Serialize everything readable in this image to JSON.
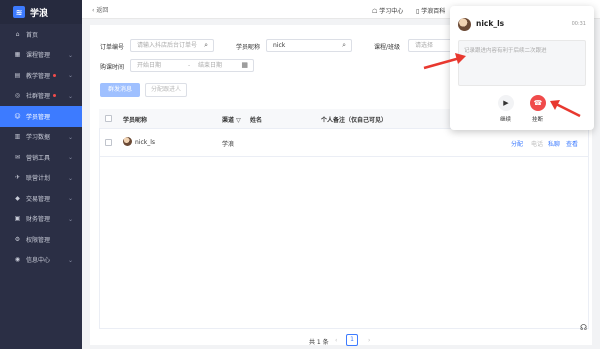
{
  "app": {
    "logo_text": "学浪",
    "logo_mark": "≋"
  },
  "sidebar": {
    "items": [
      {
        "label": "首页",
        "icon": "home-icon",
        "glyph": "⌂",
        "chevron": false,
        "dot": false,
        "active": false
      },
      {
        "label": "课程管理",
        "icon": "course-icon",
        "glyph": "▦",
        "chevron": true,
        "dot": false,
        "active": false
      },
      {
        "label": "教学管理",
        "icon": "teach-icon",
        "glyph": "▤",
        "chevron": true,
        "dot": true,
        "active": false
      },
      {
        "label": "社群管理",
        "icon": "community-icon",
        "glyph": "◎",
        "chevron": true,
        "dot": true,
        "active": false
      },
      {
        "label": "学员管理",
        "icon": "student-icon",
        "glyph": "☺",
        "chevron": false,
        "dot": false,
        "active": true
      },
      {
        "label": "学习数据",
        "icon": "data-icon",
        "glyph": "▥",
        "chevron": true,
        "dot": false,
        "active": false
      },
      {
        "label": "营销工具",
        "icon": "marketing-icon",
        "glyph": "✉",
        "chevron": true,
        "dot": false,
        "active": false
      },
      {
        "label": "联营计划",
        "icon": "plan-icon",
        "glyph": "✈",
        "chevron": true,
        "dot": false,
        "active": false
      },
      {
        "label": "交易管理",
        "icon": "trade-icon",
        "glyph": "◆",
        "chevron": true,
        "dot": false,
        "active": false
      },
      {
        "label": "财务管理",
        "icon": "finance-icon",
        "glyph": "▣",
        "chevron": true,
        "dot": false,
        "active": false
      },
      {
        "label": "权限管理",
        "icon": "permission-icon",
        "glyph": "⚙",
        "chevron": false,
        "dot": false,
        "active": false
      },
      {
        "label": "信息中心",
        "icon": "info-icon",
        "glyph": "◉",
        "chevron": true,
        "dot": false,
        "active": false
      }
    ]
  },
  "topbar": {
    "back_label": "返回",
    "learn_center": "学习中心",
    "wiki": "学浪百科"
  },
  "filters": {
    "order_label": "订单编号",
    "order_placeholder": "请输入抖店后台订单号",
    "nick_label": "学员昵称",
    "nick_value": "nick",
    "course_label": "课程/班级",
    "course_placeholder": "请选择",
    "time_label": "购课时间",
    "start_placeholder": "开始日期",
    "end_placeholder": "结束日期",
    "range_sep": "-"
  },
  "actions": {
    "send_message": "群发消息",
    "assign_advisor": "分配跟进人"
  },
  "table": {
    "headers": {
      "nick": "学员昵称",
      "channel": "渠道",
      "name": "姓名",
      "remark": "个人备注（仅自己可见）"
    },
    "rows": [
      {
        "nick": "nick_ls",
        "channel": "学浪",
        "name": "",
        "remark": ""
      }
    ],
    "ops": {
      "assign": "分配",
      "phone": "电话",
      "message": "私聊",
      "view": "查看"
    }
  },
  "pagination": {
    "total": "共 1 条",
    "prev": "‹",
    "current": "1",
    "next": "›"
  },
  "call_popup": {
    "name": "nick_ls",
    "timer": "00:31",
    "note_placeholder": "记录跟进内容有利于后续二次跟进",
    "continue_label": "继续",
    "hangup_label": "挂断"
  }
}
